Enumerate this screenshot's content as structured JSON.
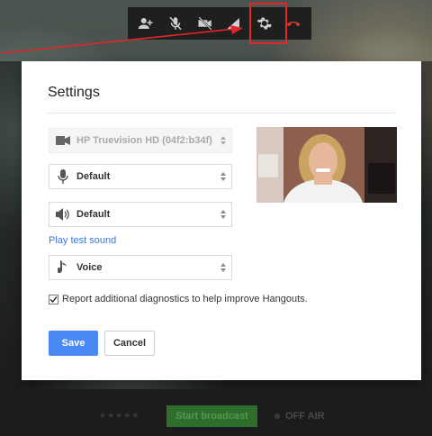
{
  "colors": {
    "accent": "#4a8af4",
    "link": "#3b78d8",
    "highlight": "#e3262b",
    "end_call": "#d9402f",
    "broadcast": "#2f6d2d"
  },
  "toolbar": {
    "items": [
      {
        "icon": "add-person-icon"
      },
      {
        "icon": "mic-mute-icon"
      },
      {
        "icon": "camera-off-icon"
      },
      {
        "icon": "signal-icon"
      },
      {
        "icon": "gear-icon"
      },
      {
        "icon": "hangup-icon"
      }
    ]
  },
  "settings": {
    "title": "Settings",
    "camera": {
      "value": "HP Truevision HD (04f2:b34f)",
      "icon": "camera-icon"
    },
    "microphone": {
      "value": "Default",
      "icon": "microphone-icon"
    },
    "speaker": {
      "value": "Default",
      "icon": "speaker-icon"
    },
    "play_test_sound": "Play test sound",
    "ringtone": {
      "value": "Voice",
      "icon": "music-note-icon"
    },
    "diagnostics": {
      "label": "Report additional diagnostics to help improve Hangouts.",
      "checked": true
    },
    "save_label": "Save",
    "cancel_label": "Cancel"
  },
  "bottom_bar": {
    "stars": "★★★★★",
    "broadcast_label": "Start broadcast",
    "status_label": "OFF AIR"
  }
}
